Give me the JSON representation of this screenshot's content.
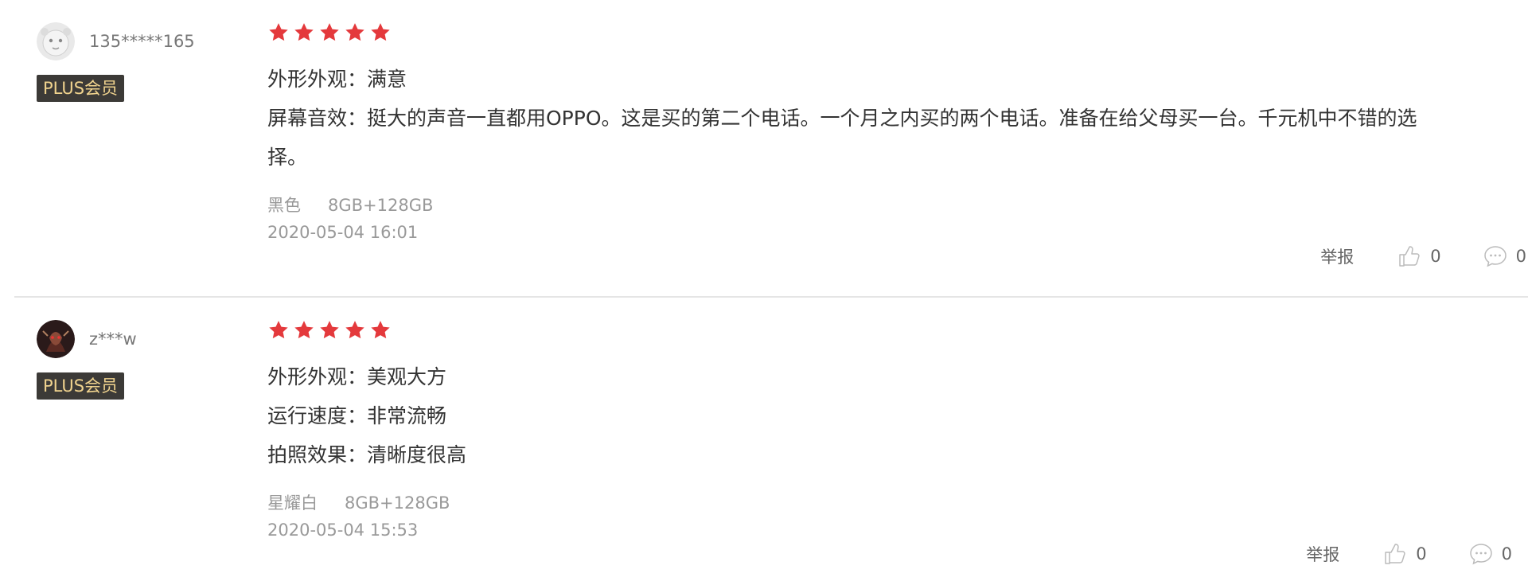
{
  "reviews": [
    {
      "username": "135*****165",
      "badge": "PLUS会员",
      "rating": 5,
      "lines": [
        "外形外观：满意",
        "屏幕音效：挺大的声音一直都用OPPO。这是买的第二个电话。一个月之内买的两个电话。准备在给父母买一台。千元机中不错的选",
        "择。"
      ],
      "color": "黑色",
      "spec": "8GB+128GB",
      "date": "2020-05-04 16:01",
      "report_label": "举报",
      "likes": "0",
      "comments": "0"
    },
    {
      "username": "z***w",
      "badge": "PLUS会员",
      "rating": 5,
      "lines": [
        "外形外观：美观大方",
        "运行速度：非常流畅",
        "拍照效果：清晰度很高"
      ],
      "color": "星耀白",
      "spec": "8GB+128GB",
      "date": "2020-05-04 15:53",
      "report_label": "举报",
      "likes": "0",
      "comments": "0"
    }
  ],
  "colors": {
    "star": "#e4393c",
    "badge_bg": "#3c3a37",
    "badge_text": "#f0d38e",
    "meta_text": "#999999"
  },
  "icons": {
    "star": "star-icon",
    "like": "thumbs-up-icon",
    "comment": "speech-bubble-icon"
  }
}
